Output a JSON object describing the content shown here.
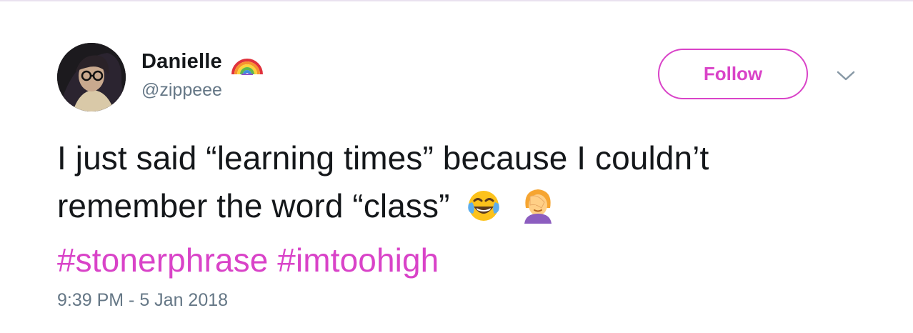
{
  "tweet": {
    "author": {
      "display_name": "Danielle",
      "handle": "@zippeee",
      "name_emoji_icon": "rainbow-icon",
      "avatar_icon": "avatar-photo"
    },
    "follow_label": "Follow",
    "caret_icon": "chevron-down-icon",
    "text": {
      "line1": "I just said “learning times” because I couldn’t",
      "line2": "remember the word “class”",
      "emojis": [
        "face-with-tears-of-joy-icon",
        "woman-facepalming-icon"
      ],
      "hashtags": [
        "#stonerphrase",
        "#imtoohigh"
      ]
    },
    "timestamp": "9:39 PM - 5 Jan 2018"
  },
  "colors": {
    "accent": "#d943c8",
    "text_primary": "#14171a",
    "text_secondary": "#657786",
    "border": "#e9e1ef"
  }
}
